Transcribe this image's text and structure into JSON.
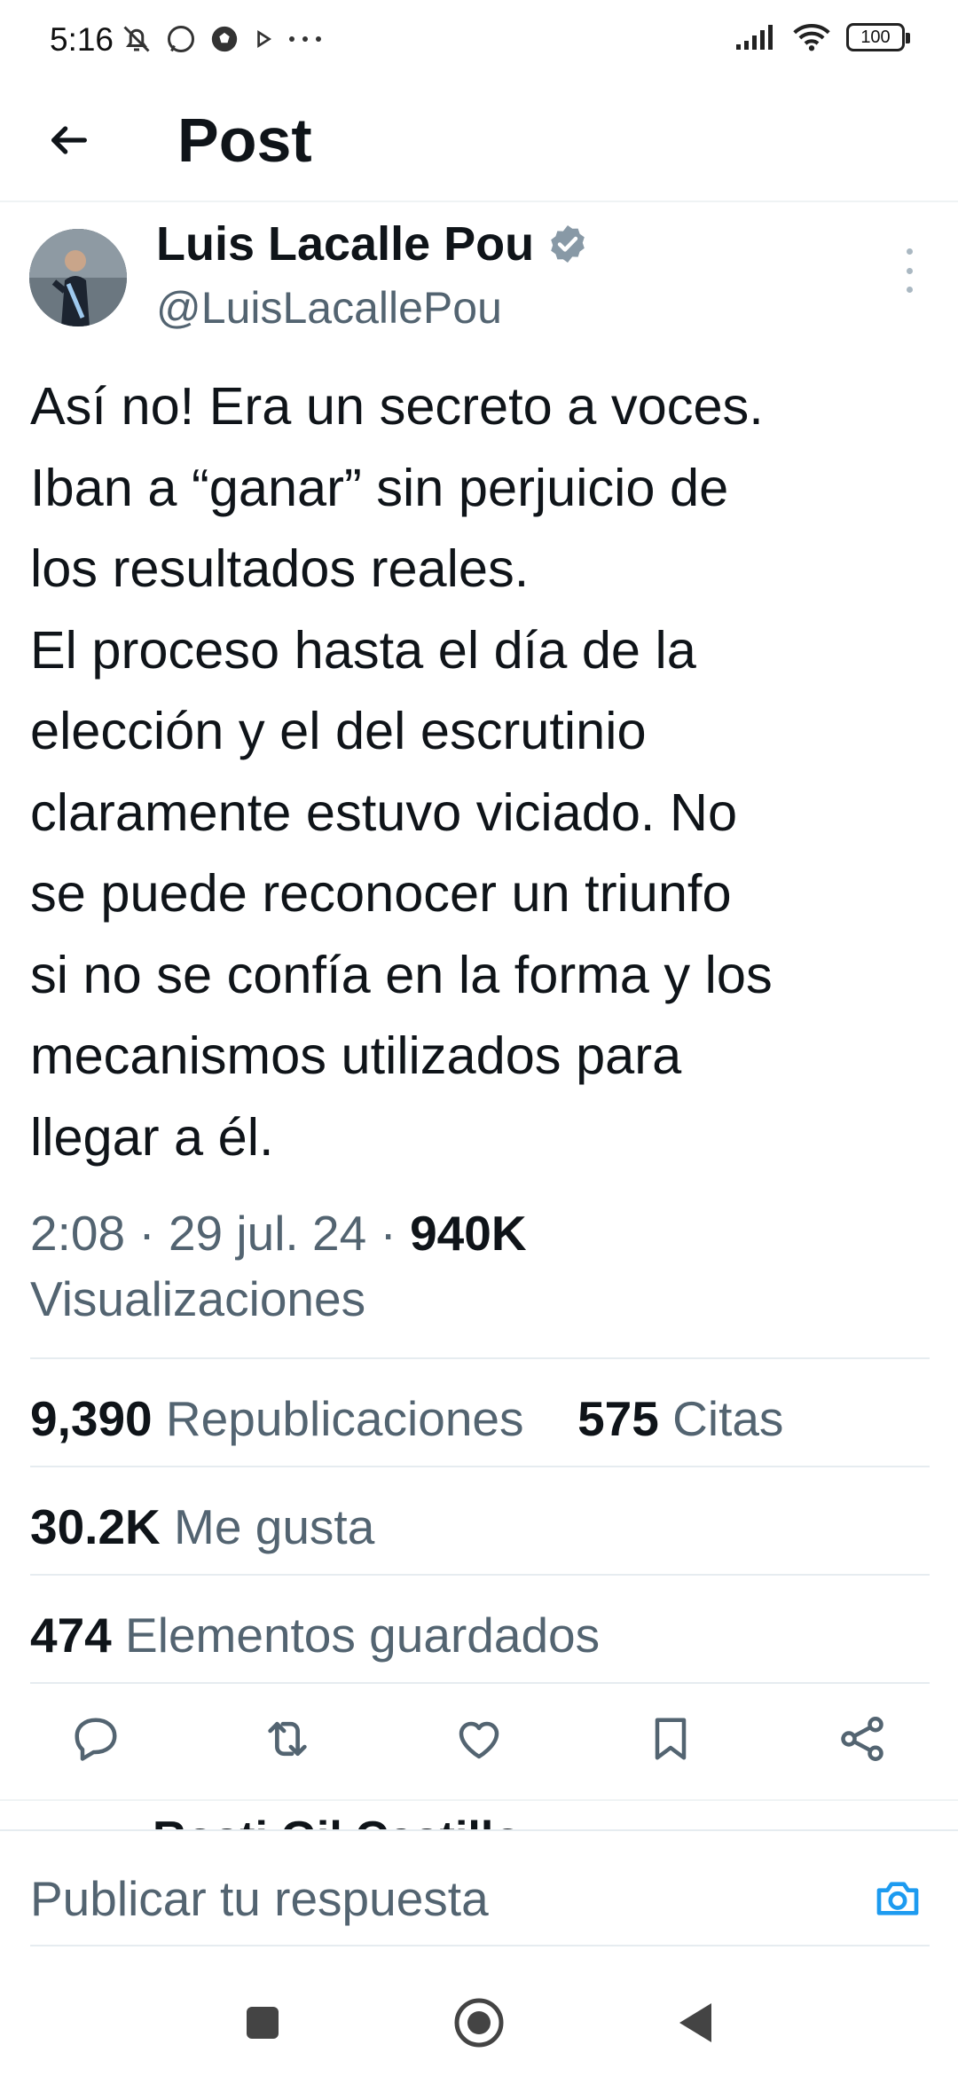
{
  "status_bar": {
    "time": "5:16",
    "battery": "100"
  },
  "header": {
    "title": "Post"
  },
  "author": {
    "name": "Luis Lacalle Pou",
    "handle": "@LuisLacallePou",
    "verified_color": "#8899a6"
  },
  "post": {
    "text": "Así no! Era un secreto a voces.\nIban a “ganar” sin perjuicio de\nlos resultados reales.\nEl proceso hasta el día de la\nelección y el del escrutinio\nclaramente estuvo viciado. No\nse puede reconocer un triunfo\nsi no se confía en la forma y los\nmecanismos utilizados para\nllegar a él.",
    "time": "2:08",
    "date": "29 jul. 24",
    "views_count": "940K",
    "views_label": "Visualizaciones",
    "separator": "·"
  },
  "stats": {
    "reposts": {
      "count": "9,390",
      "label": "Republicaciones"
    },
    "quotes": {
      "count": "575",
      "label": "Citas"
    },
    "likes": {
      "count": "30.2K",
      "label": "Me gusta"
    },
    "bookmarks": {
      "count": "474",
      "label": "Elementos guardados"
    }
  },
  "actions": [
    "reply-icon",
    "repost-icon",
    "like-icon",
    "bookmark-icon",
    "share-icon"
  ],
  "next_reply_peek": {
    "text": "Rosti Gil Castillo"
  },
  "reply_bar": {
    "placeholder": "Publicar tu respuesta",
    "accent": "#1d9bf0"
  },
  "colors": {
    "primary_text": "#0f1419",
    "secondary_text": "#536471",
    "divider": "#e6ecf0"
  }
}
